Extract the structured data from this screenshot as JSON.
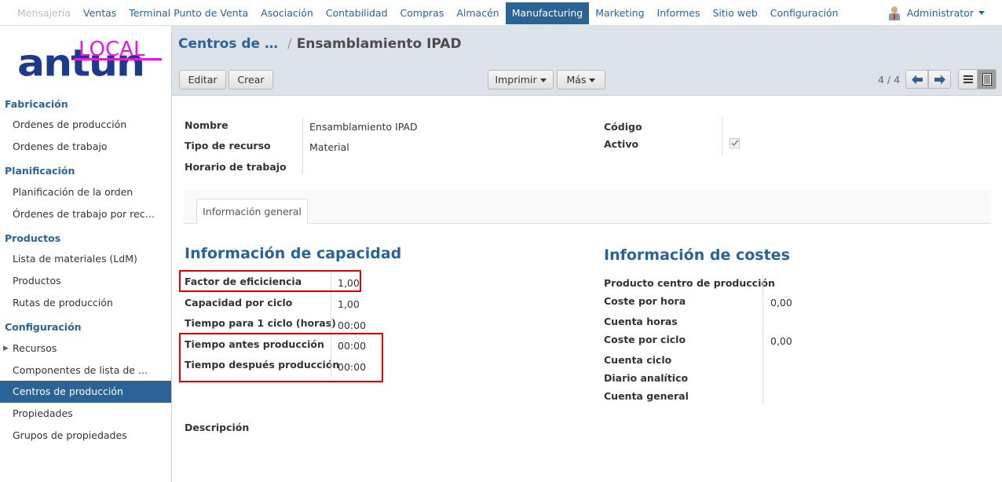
{
  "top_menu": [
    {
      "label": "Mensajería"
    },
    {
      "label": "Ventas"
    },
    {
      "label": "Terminal Punto de Venta"
    },
    {
      "label": "Asociación"
    },
    {
      "label": "Contabilidad"
    },
    {
      "label": "Compras"
    },
    {
      "label": "Almacén"
    },
    {
      "label": "Manufacturing"
    },
    {
      "label": "Marketing"
    },
    {
      "label": "Informes"
    },
    {
      "label": "Sitio web"
    },
    {
      "label": "Configuración"
    }
  ],
  "user": {
    "name": "Administrator"
  },
  "logo": {
    "word": "antun",
    "overlay": "LOCAL"
  },
  "sidebar": {
    "sections": [
      {
        "title": "Fabricación",
        "items": [
          "Ordenes de producción",
          "Ordenes de trabajo"
        ]
      },
      {
        "title": "Planificación",
        "items": [
          "Planificación de la orden",
          "Órdenes de trabajo por rec…"
        ]
      },
      {
        "title": "Productos",
        "items": [
          "Lista de materiales (LdM)",
          "Productos",
          "Rutas de producción"
        ]
      },
      {
        "title": "Configuración",
        "items": [
          "Recursos",
          "Componentes de lista de …",
          "Centros de producción",
          "Propiedades",
          "Grupos de propiedades"
        ]
      }
    ]
  },
  "breadcrumb": {
    "parent": "Centros de …",
    "separator": "/",
    "current": "Ensamblamiento IPAD"
  },
  "buttons": {
    "edit": "Editar",
    "create": "Crear",
    "print": "Imprimir",
    "more": "Más"
  },
  "pager": {
    "text": "4 / 4"
  },
  "form": {
    "nombre_label": "Nombre",
    "nombre_value": "Ensamblamiento IPAD",
    "tipo_label": "Tipo de recurso",
    "tipo_value": "Material",
    "horario_label": "Horario de trabajo",
    "horario_value": "",
    "codigo_label": "Código",
    "codigo_value": "",
    "activo_label": "Activo",
    "activo_checked": true
  },
  "tabs": [
    {
      "label": "Información general"
    }
  ],
  "capacity": {
    "heading": "Información de capacidad",
    "rows": [
      {
        "label": "Factor de eficiciencia",
        "value": "1,00"
      },
      {
        "label": "Capacidad por ciclo",
        "value": "1,00"
      },
      {
        "label": "Tiempo para 1 ciclo (horas)",
        "value": "00:00"
      },
      {
        "label": "Tiempo antes producción",
        "value": "00:00"
      },
      {
        "label": "Tiempo después producción",
        "value": "00:00"
      }
    ]
  },
  "costs": {
    "heading": "Información de costes",
    "rows": [
      {
        "label": "Producto centro de producción",
        "value": ""
      },
      {
        "label": "Coste por hora",
        "value": "0,00"
      },
      {
        "label": "Cuenta horas",
        "value": ""
      },
      {
        "label": "Coste por ciclo",
        "value": "0,00"
      },
      {
        "label": "Cuenta ciclo",
        "value": ""
      },
      {
        "label": "Diario analítico",
        "value": ""
      },
      {
        "label": "Cuenta general",
        "value": ""
      }
    ]
  },
  "description_label": "Descripción",
  "colors": {
    "brand_blue": "#2a6496",
    "highlight_red": "#e00000",
    "logo_blue": "#1d3b8a",
    "logo_magenta": "#e31be3"
  }
}
